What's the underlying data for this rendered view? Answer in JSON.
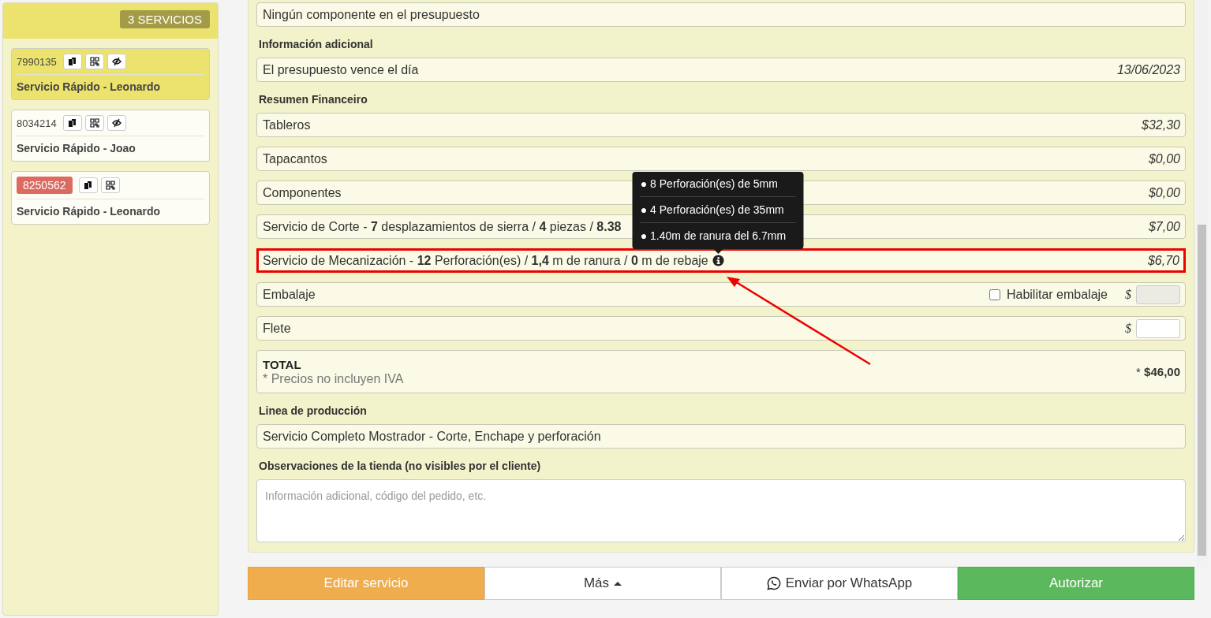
{
  "sidebar": {
    "count_badge": "3 SERVICIOS",
    "services": [
      {
        "code": "7990135",
        "code_alert": false,
        "selected": true,
        "visibility_button": true,
        "name": "Servicio Rápido - Leonardo"
      },
      {
        "code": "8034214",
        "code_alert": false,
        "selected": false,
        "visibility_button": true,
        "name": "Servicio Rápido - Joao"
      },
      {
        "code": "8250562",
        "code_alert": true,
        "selected": false,
        "visibility_button": false,
        "name": "Servicio Rápido - Leonardo"
      }
    ]
  },
  "components_note": "Ningún componente en el presupuesto",
  "additional_info": {
    "heading": "Información adicional",
    "label": "El presupuesto vence el día",
    "value": "13/06/2023"
  },
  "financial_summary": {
    "heading": "Resumen Financeiro",
    "rows": [
      {
        "kind": "amount",
        "label": "Tableros",
        "value": "$32,30",
        "highlighted": false
      },
      {
        "kind": "amount",
        "label": "Tapacantos",
        "value": "$0,00",
        "highlighted": false
      },
      {
        "kind": "amount",
        "label": "Componentes",
        "value": "$0,00",
        "highlighted": false
      },
      {
        "kind": "amount",
        "label": "Servicio de Corte - **7** desplazamientos de sierra / **4** piezas / **8.38**",
        "value": "$7,00",
        "highlighted": false
      },
      {
        "kind": "amount",
        "label": "Servicio de Mecanización - **12** Perforación(es) / **1,4** m de ranura / **0** m de rebaje",
        "value": "$6,70",
        "highlighted": true,
        "tooltip": [
          "● 8 Perforación(es) de 5mm",
          "● 4 Perforación(es) de 35mm",
          "● 1.40m de ranura del 6.7mm"
        ]
      },
      {
        "kind": "input",
        "label": "Embalaje",
        "checkbox": {
          "label": "Habilitar embalaje",
          "checked": false
        },
        "currency": "$",
        "disabled": true,
        "highlighted": false
      },
      {
        "kind": "input",
        "label": "Flete",
        "currency": "$",
        "disabled": false,
        "highlighted": false
      },
      {
        "kind": "total",
        "label": "TOTAL",
        "note": "* Precios no incluyen IVA",
        "value": "* **$46,00**",
        "highlighted": false
      }
    ]
  },
  "production_line": {
    "heading": "Linea de producción",
    "value": "Servicio Completo Mostrador - Corte, Enchape y perforación"
  },
  "store_notes": {
    "heading": "Observaciones de la tienda (no visibles por el cliente)",
    "placeholder": "Información adicional, código del pedido, etc."
  },
  "annotation_arrow": true,
  "buttons": [
    {
      "kind": "warning",
      "label": "Editar servicio"
    },
    {
      "kind": "dropdown",
      "label": "Más"
    },
    {
      "kind": "whatsapp",
      "label": "Enviar por WhatsApp"
    },
    {
      "kind": "success",
      "label": "Autorizar"
    }
  ]
}
